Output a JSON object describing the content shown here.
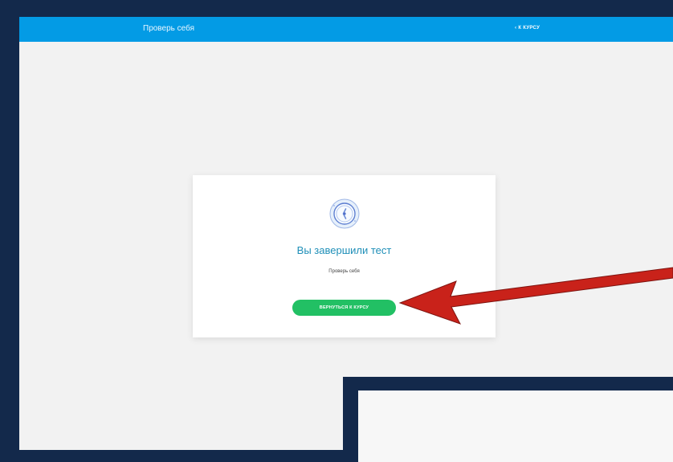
{
  "header": {
    "title": "Проверь себя",
    "back_label": "К КУРСУ",
    "back_icon": "chevron-left-icon"
  },
  "result_card": {
    "badge_icon": "compass-badge-icon",
    "title": "Вы завершили тест",
    "subtitle": "Проверь себя",
    "button_label": "ВЕРНУТЬСЯ К КУРСУ"
  },
  "colors": {
    "topbar": "#039be5",
    "frame": "#13294b",
    "button": "#22c064",
    "title": "#1f8fb8",
    "arrow": "#c9221a"
  }
}
